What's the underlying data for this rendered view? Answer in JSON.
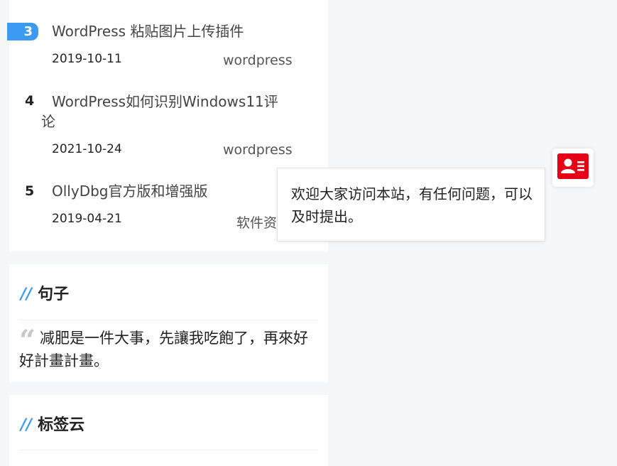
{
  "ranking": {
    "items": [
      {
        "rank": "3",
        "title": "WordPress 粘贴图片上传插件",
        "date": "2019-10-11",
        "tag": "wordpress"
      },
      {
        "rank": "4",
        "title_line1": "WordPress如何识别Windows11评",
        "title_line2": "论",
        "date": "2021-10-24",
        "tag": "wordpress"
      },
      {
        "rank": "5",
        "title": "OllyDbg官方版和增强版",
        "date": "2019-04-21",
        "tag": "软件资"
      }
    ]
  },
  "sentence": {
    "heading_slash": "//",
    "heading": "句子",
    "text": "减肥是一件大事，先讓我吃飽了，再來好好計畫計畫。"
  },
  "tag_cloud": {
    "heading_slash": "//",
    "heading": "标签云"
  },
  "contact": {
    "icon": "contact-card-icon",
    "accent_color": "#e50016",
    "popup_text": "欢迎大家访问本站，有任何问题，可以及时提出。"
  },
  "colors": {
    "accent": "#3d9af2",
    "background": "#f6f7f9"
  }
}
